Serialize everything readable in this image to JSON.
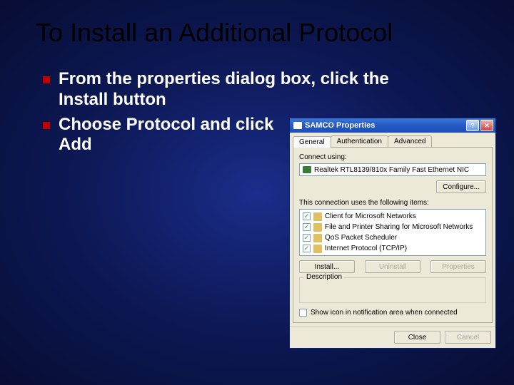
{
  "title": "To Install an Additional Protocol",
  "bullets": [
    "From the properties dialog box, click the Install button",
    "Choose Protocol and click Add"
  ],
  "dialog": {
    "window_title": "SAMCO Properties",
    "help_btn": "?",
    "close_btn": "✕",
    "tabs": [
      "General",
      "Authentication",
      "Advanced"
    ],
    "connect_label": "Connect using:",
    "adapter": "Realtek RTL8139/810x Family Fast Ethernet NIC",
    "configure_btn": "Configure...",
    "items_label": "This connection uses the following items:",
    "items": [
      "Client for Microsoft Networks",
      "File and Printer Sharing for Microsoft Networks",
      "QoS Packet Scheduler",
      "Internet Protocol (TCP/IP)"
    ],
    "install_btn": "Install...",
    "uninstall_btn": "Uninstall",
    "properties_btn": "Properties",
    "description_label": "Description",
    "show_icon_label": "Show icon in notification area when connected",
    "close_footer": "Close",
    "cancel_footer": "Cancel"
  }
}
